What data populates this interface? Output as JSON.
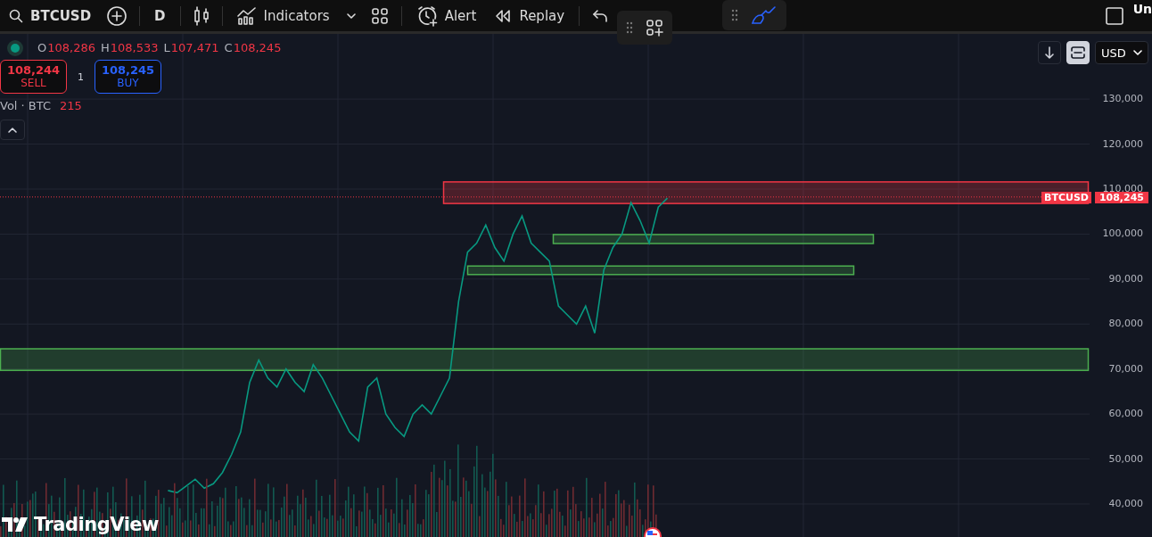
{
  "toolbar": {
    "symbol": "BTCUSD",
    "interval": "D",
    "indicators": "Indicators",
    "alert": "Alert",
    "replay": "Replay",
    "cut_label": "Un"
  },
  "legend": {
    "ohlc": [
      {
        "label": "O",
        "value": "108,286"
      },
      {
        "label": "H",
        "value": "108,533"
      },
      {
        "label": "L",
        "value": "107,471"
      },
      {
        "label": "C",
        "value": "108,245"
      }
    ],
    "sell": {
      "price": "108,244",
      "label": "SELL"
    },
    "quantity": "1",
    "buy": {
      "price": "108,245",
      "label": "BUY"
    },
    "volume": {
      "label": "Vol · BTC",
      "value": "215"
    }
  },
  "price_scale": {
    "currency": "USD",
    "auto_scale_on": true
  },
  "chart_data": {
    "type": "line",
    "grid": true,
    "ylim": [
      32660,
      144500
    ],
    "yticks": [
      {
        "value": 40000,
        "label": "40,000"
      },
      {
        "value": 50000,
        "label": "50,000"
      },
      {
        "value": 60000,
        "label": "60,000"
      },
      {
        "value": 70000,
        "label": "70,000"
      },
      {
        "value": 80000,
        "label": "80,000"
      },
      {
        "value": 90000,
        "label": "90,000"
      },
      {
        "value": 100000,
        "label": "100,000"
      },
      {
        "value": 110000,
        "label": "110,000"
      },
      {
        "value": 120000,
        "label": "120,000"
      },
      {
        "value": 130000,
        "label": "130,000"
      }
    ],
    "series": [
      {
        "name": "BTCUSD",
        "color": "#089981",
        "values": [
          null,
          null,
          null,
          null,
          null,
          null,
          null,
          null,
          null,
          null,
          null,
          null,
          null,
          null,
          null,
          null,
          null,
          null,
          43000,
          42500,
          44000,
          45500,
          43500,
          44500,
          47000,
          51000,
          56000,
          67000,
          72000,
          68000,
          66000,
          70000,
          67000,
          65000,
          71000,
          68000,
          64000,
          60000,
          56000,
          54000,
          66000,
          68000,
          60000,
          57000,
          55000,
          60000,
          62000,
          60000,
          64000,
          68000,
          85000,
          96000,
          98000,
          102000,
          97000,
          94000,
          100000,
          104000,
          98000,
          96000,
          94000,
          84000,
          82000,
          80000,
          84000,
          78000,
          92000,
          97000,
          100000,
          107000,
          103000,
          98000,
          106000,
          108000,
          null,
          null,
          null,
          null,
          null,
          null,
          null,
          null,
          null,
          null,
          null,
          null,
          null,
          null,
          null,
          null,
          null,
          null,
          null,
          null,
          null,
          null,
          null,
          null,
          null,
          null,
          null,
          null,
          null,
          null,
          null,
          null,
          null,
          null,
          null,
          null,
          null,
          null,
          null,
          null,
          null,
          null,
          null,
          null,
          null,
          null
        ]
      }
    ],
    "bands": [
      {
        "axis": "y",
        "from": 106800,
        "to": 111600,
        "color": "#f23645"
      },
      {
        "axis": "y",
        "from": 97900,
        "to": 99900,
        "color": "#4caf50"
      },
      {
        "axis": "y",
        "from": 91000,
        "to": 92900,
        "color": "#4caf50"
      },
      {
        "axis": "y",
        "from": 69700,
        "to": 74500,
        "color": "#4caf50"
      }
    ],
    "ref_lines": [
      {
        "axis": "y",
        "value": 108245,
        "label": "108,245",
        "color": "#f23645"
      }
    ]
  },
  "logo": "TradingView"
}
